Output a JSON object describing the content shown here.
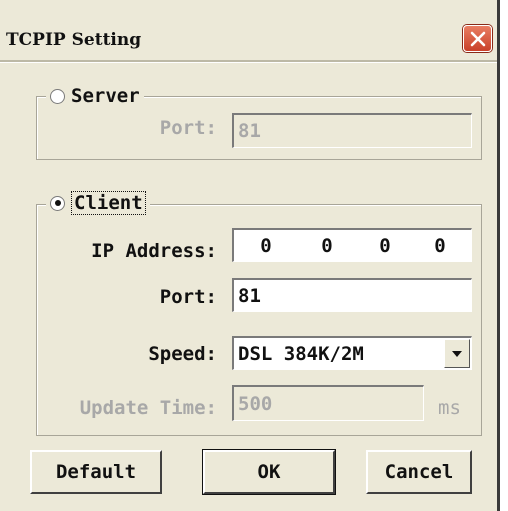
{
  "window": {
    "title": "TCPIP Setting"
  },
  "server": {
    "label": "Server",
    "port_label": "Port:",
    "port_value": "81"
  },
  "client": {
    "label": "Client",
    "ip_label": "IP Address:",
    "ip_parts": [
      "0",
      "0",
      "0",
      "0"
    ],
    "port_label": "Port:",
    "port_value": "81",
    "speed_label": "Speed:",
    "speed_value": "DSL 384K/2M",
    "update_label": "Update Time:",
    "update_value": "500",
    "update_unit": "ms"
  },
  "buttons": {
    "default": "Default",
    "ok": "OK",
    "cancel": "Cancel"
  },
  "colors": {
    "dialog_bg": "#ece9d8",
    "close_button": "#d5553b",
    "disabled_text": "#a8a8a8"
  },
  "icons": [
    "close-icon",
    "radio-unselected-icon",
    "radio-selected-icon",
    "dropdown-arrow-icon"
  ]
}
